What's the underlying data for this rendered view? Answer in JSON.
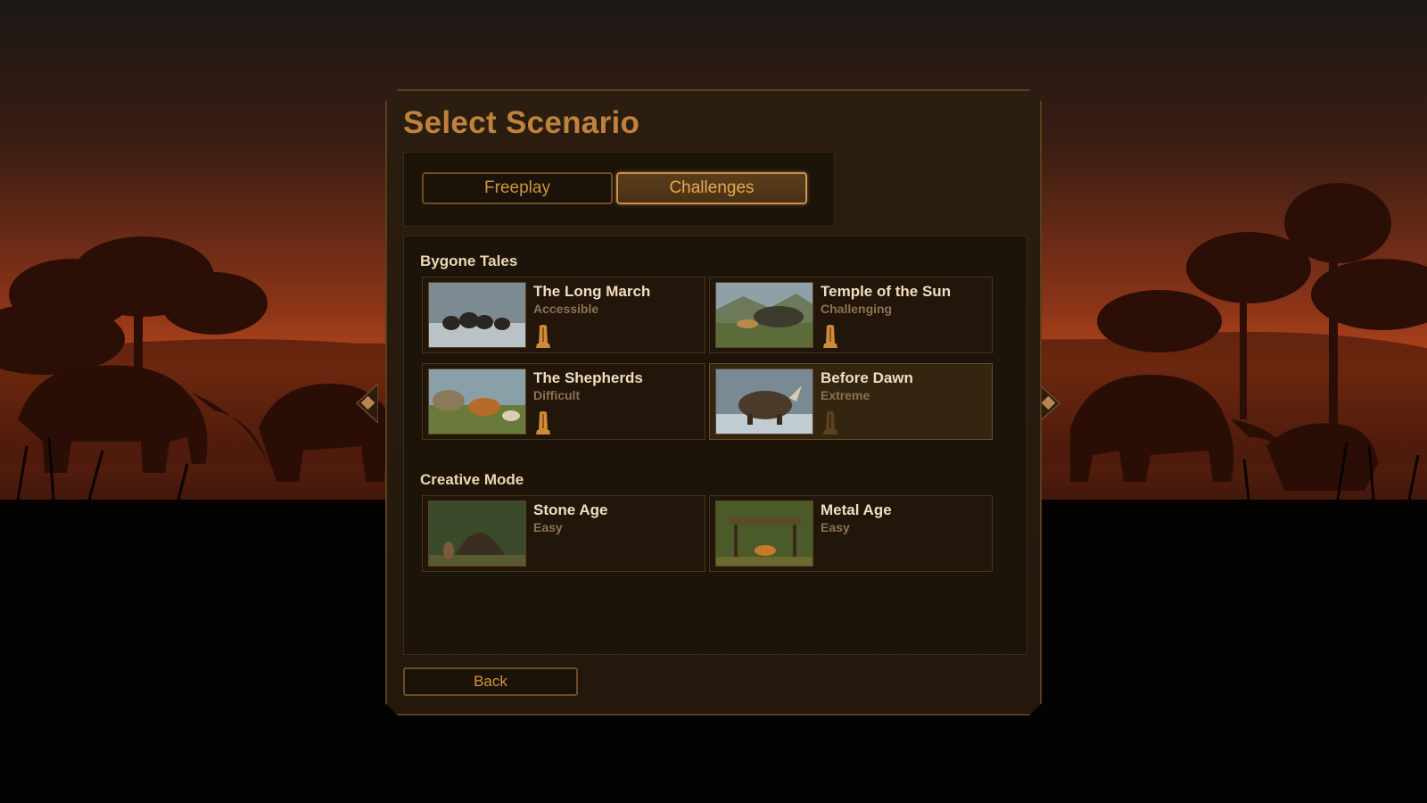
{
  "screen": {
    "title": "Select Scenario",
    "tabs": [
      {
        "label": "Freeplay",
        "active": false
      },
      {
        "label": "Challenges",
        "active": true
      }
    ],
    "back_label": "Back"
  },
  "sections": [
    {
      "title": "Bygone Tales",
      "cards": [
        {
          "name": "The Long March",
          "difficulty": "Accessible",
          "icon": "totem-icon",
          "icon_dim": false
        },
        {
          "name": "Temple of the Sun",
          "difficulty": "Challenging",
          "icon": "totem-icon",
          "icon_dim": false
        },
        {
          "name": "The Shepherds",
          "difficulty": "Difficult",
          "icon": "totem-icon",
          "icon_dim": false
        },
        {
          "name": "Before Dawn",
          "difficulty": "Extreme",
          "icon": "totem-icon",
          "icon_dim": true
        }
      ]
    },
    {
      "title": "Creative Mode",
      "cards": [
        {
          "name": "Stone Age",
          "difficulty": "Easy"
        },
        {
          "name": "Metal Age",
          "difficulty": "Easy"
        }
      ]
    }
  ],
  "colors": {
    "accent": "#c0813d",
    "tab_text": "#d4913f",
    "card_title": "#f0dcc0",
    "card_subtitle": "#8c7152",
    "panel_bg": "#2b1d0f",
    "sky_top": "#2a1410",
    "sky_horizon": "#c4501c"
  }
}
